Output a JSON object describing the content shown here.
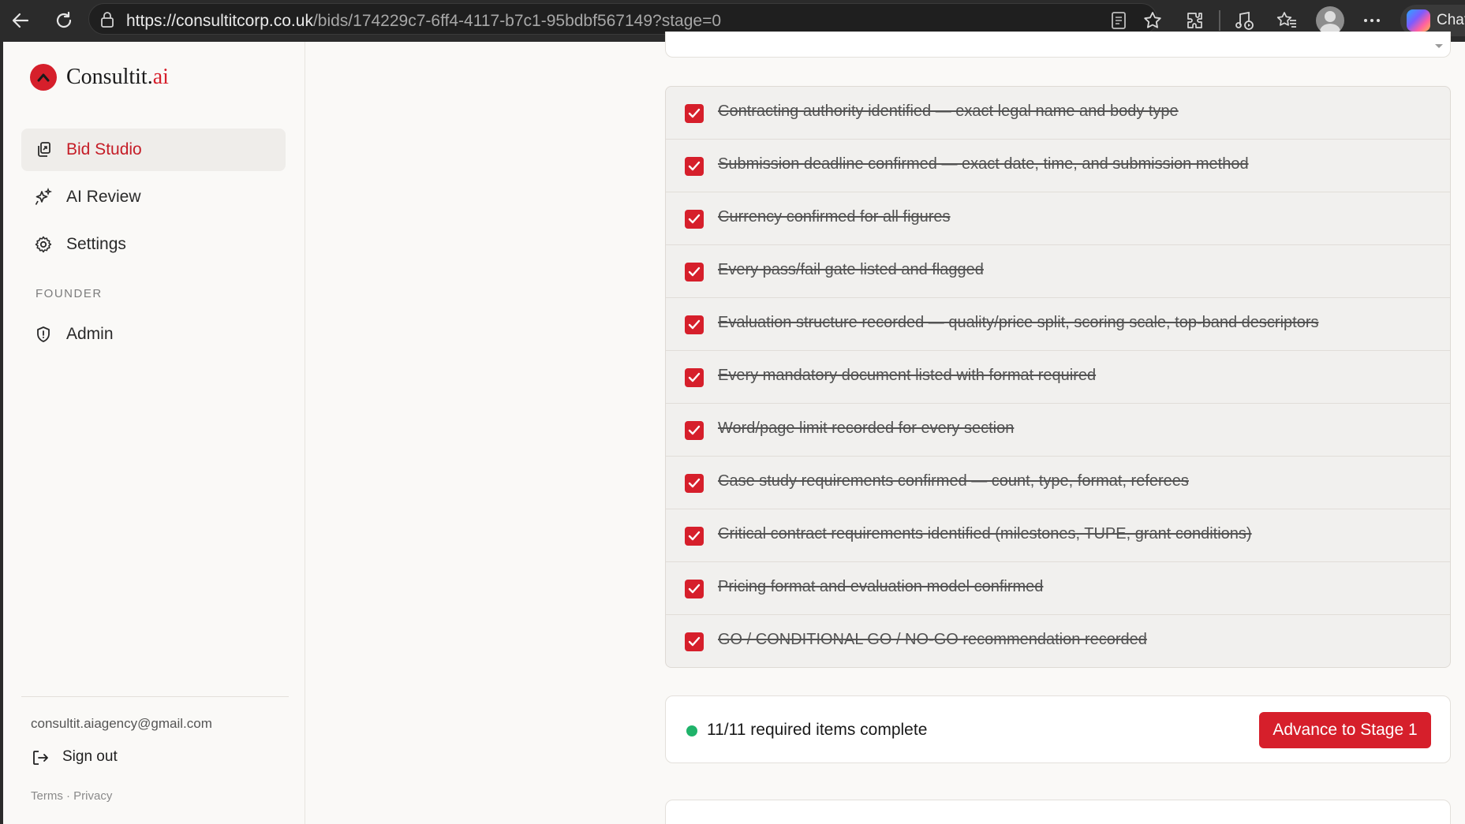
{
  "browser": {
    "url_host": "https://consultitcorp.co.uk",
    "url_path": "/bids/174229c7-6ff4-4117-b7c1-95bdbf567149?stage=0",
    "copilot_label": "Chat",
    "icons": [
      "back-icon",
      "refresh-icon",
      "lock-icon",
      "reader-icon",
      "favorite-star-icon",
      "extensions-icon",
      "media-icon",
      "favorites-icon",
      "profile-avatar",
      "more-icon",
      "copilot-icon"
    ]
  },
  "sidebar": {
    "brand_prefix": "Consultit.",
    "brand_suffix": "ai",
    "nav": [
      {
        "label": "Bid Studio",
        "icon": "bid-studio-icon",
        "active": true
      },
      {
        "label": "AI Review",
        "icon": "sparkles-icon",
        "active": false
      },
      {
        "label": "Settings",
        "icon": "gear-icon",
        "active": false
      }
    ],
    "section_label": "FOUNDER",
    "admin_label": "Admin",
    "email": "consultit.aiagency@gmail.com",
    "signout_label": "Sign out",
    "footer_links": "Terms · Privacy"
  },
  "checklist": {
    "items": [
      {
        "label": "Contracting authority identified — exact legal name and body type",
        "checked": true
      },
      {
        "label": "Submission deadline confirmed — exact date, time, and submission method",
        "checked": true
      },
      {
        "label": "Currency confirmed for all figures",
        "checked": true
      },
      {
        "label": "Every pass/fail gate listed and flagged",
        "checked": true
      },
      {
        "label": "Evaluation structure recorded — quality/price split, scoring scale, top-band descriptors",
        "checked": true
      },
      {
        "label": "Every mandatory document listed with format required",
        "checked": true
      },
      {
        "label": "Word/page limit recorded for every section",
        "checked": true
      },
      {
        "label": "Case study requirements confirmed — count, type, format, referees",
        "checked": true
      },
      {
        "label": "Critical contract requirements identified (milestones, TUPE, grant conditions)",
        "checked": true
      },
      {
        "label": "Pricing format and evaluation model confirmed",
        "checked": true
      },
      {
        "label": "GO / CONDITIONAL GO / NO-GO recommendation recorded",
        "checked": true
      }
    ]
  },
  "status": {
    "text": "11/11 required items complete",
    "button_label": "Advance to Stage 1"
  },
  "colors": {
    "accent": "#d61f2b",
    "success": "#1fb36a"
  }
}
